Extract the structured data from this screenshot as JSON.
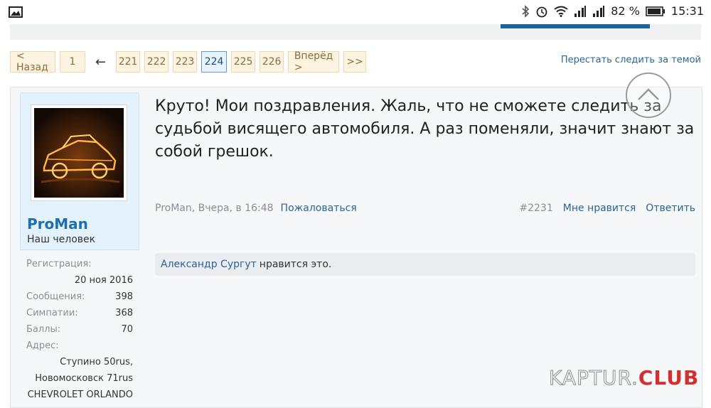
{
  "status_bar": {
    "battery": "82 %",
    "time": "15:31",
    "icons": [
      "image-icon",
      "bluetooth-icon",
      "alarm-icon",
      "wifi-icon",
      "signal-icon",
      "signal-icon",
      "battery-icon"
    ]
  },
  "pagination": {
    "prev": "< Назад",
    "first": "1",
    "ellipsis_arrow": "←",
    "pages": [
      "221",
      "222",
      "223",
      "224",
      "225",
      "226"
    ],
    "current": "224",
    "next": "Вперёд >",
    "last": ">>"
  },
  "unwatch_link": "Перестать следить за темой",
  "user": {
    "name": "ProMan",
    "title": "Наш человек",
    "reg_label": "Регистрация:",
    "reg_value": "20 ноя 2016",
    "messages_label": "Сообщения:",
    "messages_value": "398",
    "likes_label": "Симпатии:",
    "likes_value": "368",
    "points_label": "Баллы:",
    "points_value": "70",
    "address_label": "Адрес:",
    "address_line1": "Ступино 50rus,",
    "address_line2": "Новомосковск 71rus",
    "car": "CHEVROLET ORLANDO"
  },
  "post": {
    "text": "Круто! Мои поздравления. Жаль, что не сможете следить за судьбой висящего автомобиля. А раз поменяли, значит знают за собой грешок.",
    "author_date": "ProMan, Вчера, в 16:48",
    "report": "Пожаловаться",
    "number": "#2231",
    "like": "Мне нравится",
    "reply": "Ответить",
    "liked_by": "Александр Сургут",
    "liked_suffix": "нравится это."
  },
  "watermark": {
    "part1": "KAPTUR.",
    "part2": "CLUB"
  },
  "colors": {
    "link": "#2a6496",
    "username": "#1f6fb0",
    "pager_bg": "#fdf3e1",
    "pager_current": "#e8f2fb",
    "brand_red": "#d32f2f"
  }
}
